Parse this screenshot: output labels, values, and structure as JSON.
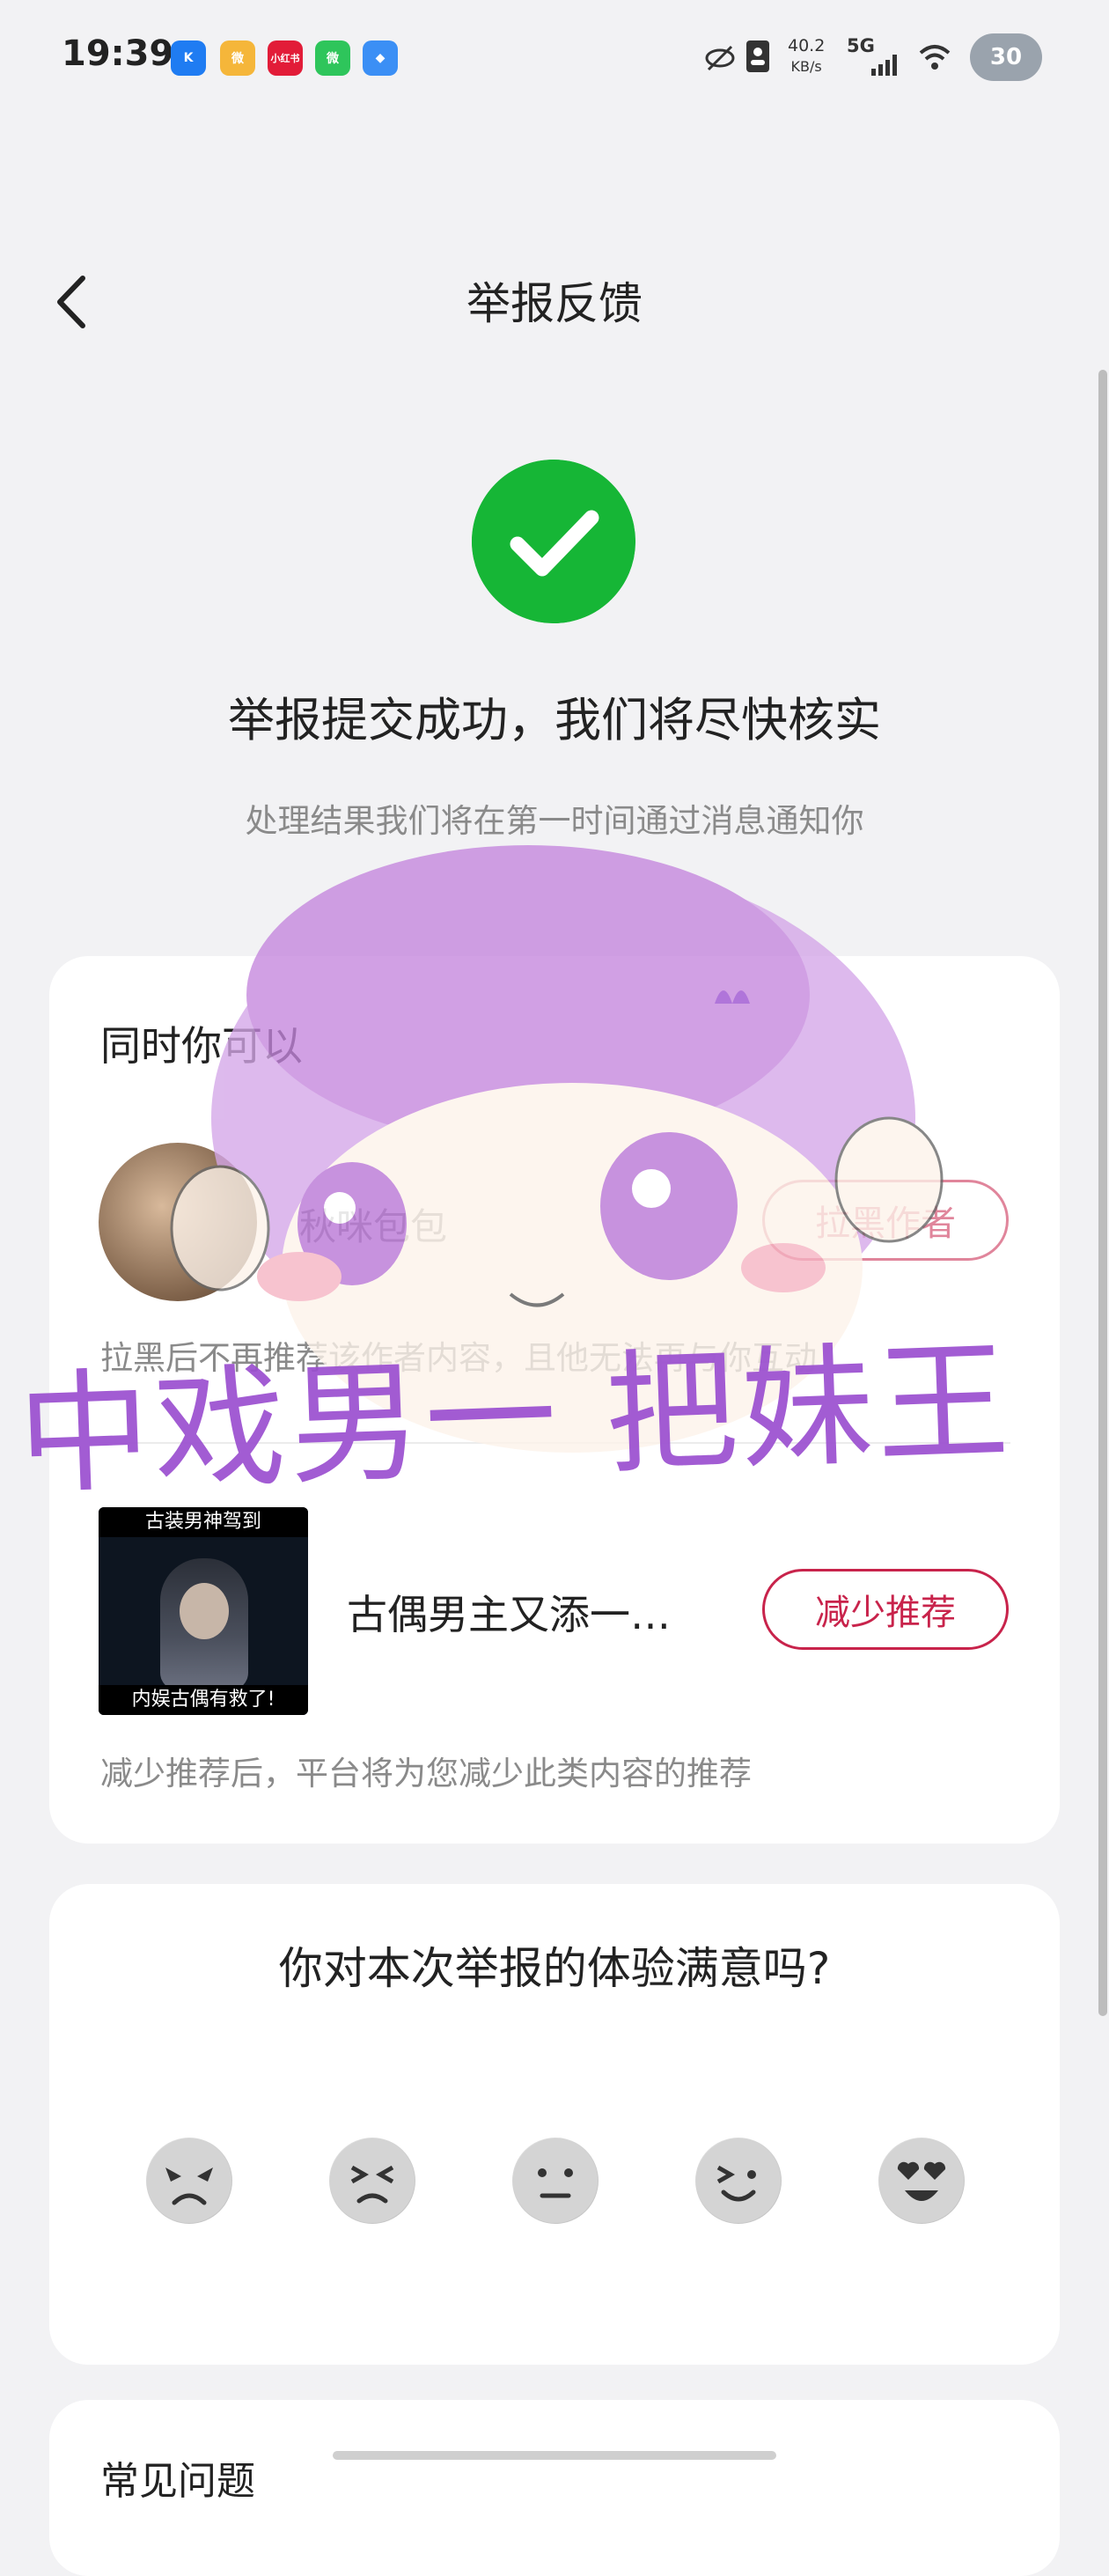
{
  "status_bar": {
    "time": "19:39",
    "app_icons": [
      {
        "name": "k-app-icon",
        "label": "K",
        "color": "#1f7cf2"
      },
      {
        "name": "weibo-icon",
        "label": "微",
        "color": "#f5b63a"
      },
      {
        "name": "xiaohongshu-icon",
        "label": "小红书",
        "color": "#e21c38"
      },
      {
        "name": "wechat-icon",
        "label": "微",
        "color": "#2ec55b"
      },
      {
        "name": "blue-app-icon",
        "label": "◆",
        "color": "#3b8ff5"
      }
    ],
    "net_speed_value": "40.2",
    "net_speed_unit": "KB/s",
    "network": "5G",
    "battery": "30"
  },
  "nav": {
    "title": "举报反馈"
  },
  "success": {
    "headline": "举报提交成功，我们将尽快核实",
    "subtext": "处理结果我们将在第一时间通过消息通知你"
  },
  "actions_card": {
    "heading": "同时你可以",
    "author": {
      "name": "秋咪包包",
      "button_label": "拉黑作者",
      "description": "拉黑后不再推荐该作者内容，且他无法再与你互动"
    },
    "video": {
      "thumb_top_text": "古装男神驾到",
      "thumb_bottom_text": "内娱古偶有救了!",
      "title": "古偶男主又添一…",
      "button_label": "减少推荐",
      "description": "减少推荐后，平台将为您减少此类内容的推荐"
    }
  },
  "satisfaction": {
    "question": "你对本次举报的体验满意吗?",
    "ratings": [
      {
        "name": "very-unsatisfied-emoji-icon",
        "face": "angry"
      },
      {
        "name": "unsatisfied-emoji-icon",
        "face": "frown"
      },
      {
        "name": "neutral-emoji-icon",
        "face": "neutral"
      },
      {
        "name": "satisfied-emoji-icon",
        "face": "smile"
      },
      {
        "name": "very-satisfied-emoji-icon",
        "face": "love"
      }
    ]
  },
  "next_card": {
    "label": "常见问题"
  },
  "sticker": {
    "text": "中戏男一 把妹王"
  },
  "colors": {
    "accent": "#c8234b",
    "success": "#16b636",
    "sticker": "#9b4fd0"
  }
}
